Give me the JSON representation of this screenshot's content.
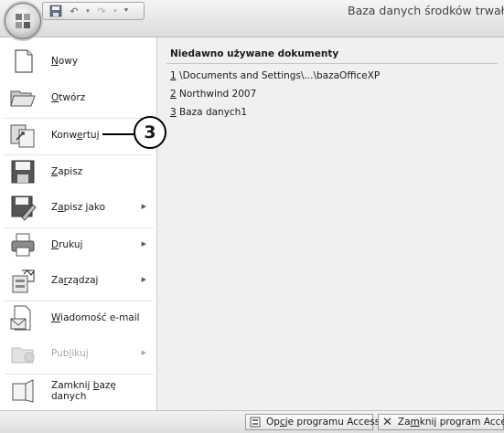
{
  "window": {
    "title": "Baza danych środków trwałych"
  },
  "quick_access": {
    "icons": [
      "save-icon",
      "undo-icon",
      "redo-icon",
      "customize-qat-icon"
    ]
  },
  "menu": {
    "commands": [
      {
        "pre": "",
        "key": "N",
        "post": "owy",
        "icon": "new-icon"
      },
      {
        "pre": "",
        "key": "O",
        "post": "twórz",
        "icon": "open-icon"
      },
      {
        "pre": "Konw",
        "key": "e",
        "post": "rtuj",
        "icon": "convert-icon"
      },
      {
        "pre": "",
        "key": "Z",
        "post": "apisz",
        "icon": "save-icon"
      },
      {
        "pre": "Z",
        "key": "a",
        "post": "pisz jako",
        "icon": "save-as-icon"
      },
      {
        "pre": "",
        "key": "D",
        "post": "rukuj",
        "icon": "print-icon"
      },
      {
        "pre": "Za",
        "key": "r",
        "post": "ządzaj",
        "icon": "manage-icon"
      },
      {
        "pre": "",
        "key": "W",
        "post": "iadomość e-mail",
        "icon": "email-icon"
      },
      {
        "pre": "Pub",
        "key": "l",
        "post": "ikuj",
        "icon": "publish-icon"
      },
      {
        "pre": "Zamknij ",
        "key": "b",
        "post": "azę danych",
        "icon": "close-database-icon"
      }
    ]
  },
  "recent": {
    "title": "Niedawno używane dokumenty",
    "items": [
      {
        "num": "1",
        "name": " \\Documents and Settings\\...\\bazaOfficeXP"
      },
      {
        "num": "2",
        "name": " Northwind 2007"
      },
      {
        "num": "3",
        "name": " Baza danych1"
      }
    ]
  },
  "callout": {
    "label": "3"
  },
  "footer": {
    "options": {
      "pre": "Op",
      "key": "c",
      "post": "je programu Access"
    },
    "exit": {
      "pre": "Za",
      "key": "m",
      "post": "knij program Access"
    }
  }
}
